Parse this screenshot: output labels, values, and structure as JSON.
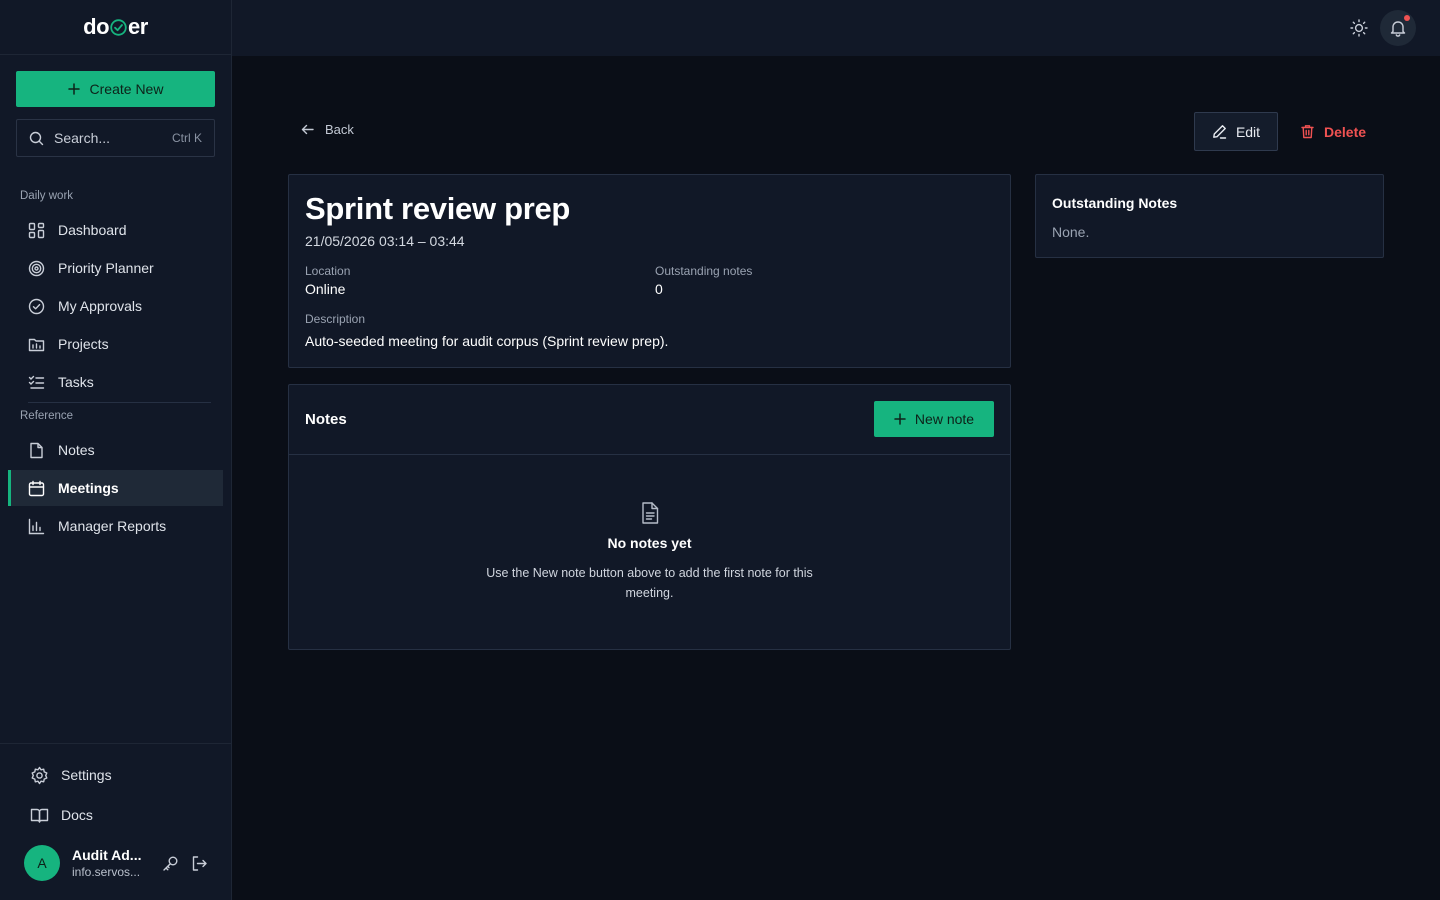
{
  "app": {
    "logo_left": "do",
    "logo_right": "er"
  },
  "sidebar": {
    "create_label": "Create New",
    "search_placeholder": "Search...",
    "search_shortcut": "Ctrl K",
    "section_daily": "Daily work",
    "section_reference": "Reference",
    "items": [
      {
        "label": "Dashboard",
        "icon": "dashboard-icon"
      },
      {
        "label": "Priority Planner",
        "icon": "target-icon"
      },
      {
        "label": "My Approvals",
        "icon": "check-circle-icon"
      },
      {
        "label": "Projects",
        "icon": "projects-icon"
      },
      {
        "label": "Tasks",
        "icon": "tasks-icon"
      },
      {
        "label": "Notes",
        "icon": "note-icon"
      },
      {
        "label": "Meetings",
        "icon": "calendar-icon",
        "active": true
      },
      {
        "label": "Manager Reports",
        "icon": "bar-chart-icon"
      }
    ],
    "settings_label": "Settings",
    "docs_label": "Docs",
    "user": {
      "initial": "A",
      "name": "Audit Ad...",
      "email": "info.servos..."
    }
  },
  "page": {
    "back_label": "Back",
    "edit_label": "Edit",
    "delete_label": "Delete",
    "meeting": {
      "title": "Sprint review prep",
      "time": "21/05/2026 03:14 – 03:44",
      "location_label": "Location",
      "location": "Online",
      "outstanding_label": "Outstanding notes",
      "outstanding_count": "0",
      "description_label": "Description",
      "description": "Auto-seeded meeting for audit corpus (Sprint review prep)."
    },
    "notes": {
      "title": "Notes",
      "new_note_label": "New note",
      "empty_title": "No notes yet",
      "empty_desc": "Use the New note button above to add the first note for this meeting."
    },
    "outstanding_panel": {
      "title": "Outstanding Notes",
      "value": "None."
    }
  },
  "colors": {
    "accent": "#16b47f",
    "danger": "#f05252",
    "surface": "#111827",
    "background": "#0a0e17"
  }
}
